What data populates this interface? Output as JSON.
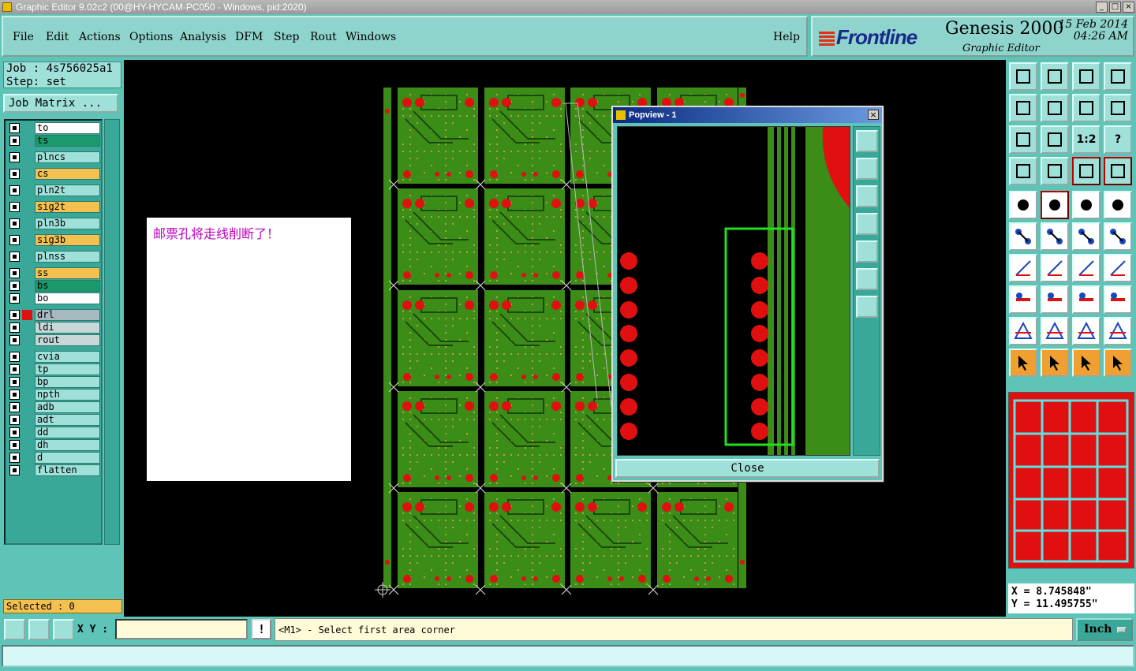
{
  "window": {
    "title": "Graphic Editor 9.02c2 (00@HY-HYCAM-PC050 - Windows, pid:2020)"
  },
  "menu": [
    "File",
    "Edit",
    "Actions",
    "Options",
    "Analysis",
    "DFM",
    "Step",
    "Rout",
    "Windows"
  ],
  "help": "Help",
  "brand": {
    "logo": "Frontline",
    "product": "Genesis 2000",
    "subtitle": "Graphic Editor",
    "date": "15 Feb 2014",
    "time": "04:26 AM"
  },
  "job": {
    "job_line": "Job : 4s756025a1",
    "step_line": "Step: set",
    "matrix_button": "Job Matrix ..."
  },
  "layers": [
    {
      "name": "to",
      "color": "#ffffff"
    },
    {
      "name": "ts",
      "color": "#1a9a6a"
    },
    {
      "name": "plncs",
      "color": "#9fe0d8"
    },
    {
      "name": "cs",
      "color": "#f4c050"
    },
    {
      "name": "pln2t",
      "color": "#9fe0d8"
    },
    {
      "name": "sig2t",
      "color": "#f4c050"
    },
    {
      "name": "pln3b",
      "color": "#9fe0d8"
    },
    {
      "name": "sig3b",
      "color": "#f4c050"
    },
    {
      "name": "plnss",
      "color": "#9fe0d8"
    },
    {
      "name": "ss",
      "color": "#f4c050"
    },
    {
      "name": "bs",
      "color": "#1a9a6a"
    },
    {
      "name": "bo",
      "color": "#ffffff"
    },
    {
      "name": "drl",
      "color": "#a8b8c0"
    },
    {
      "name": "ldi",
      "color": "#c8d8d8"
    },
    {
      "name": "rout",
      "color": "#c8d8d8"
    },
    {
      "name": "cvia",
      "color": "#9fe0d8"
    },
    {
      "name": "tp",
      "color": "#9fe0d8"
    },
    {
      "name": "bp",
      "color": "#9fe0d8"
    },
    {
      "name": "npth",
      "color": "#9fe0d8"
    },
    {
      "name": "adb",
      "color": "#9fe0d8"
    },
    {
      "name": "adt",
      "color": "#9fe0d8"
    },
    {
      "name": "dd",
      "color": "#9fe0d8"
    },
    {
      "name": "dh",
      "color": "#9fe0d8"
    },
    {
      "name": "d",
      "color": "#9fe0d8"
    },
    {
      "name": "flatten",
      "color": "#9fe0d8"
    }
  ],
  "selected": "Selected : 0",
  "note": "邮票孔将走线削断了！",
  "popview": {
    "title": "Popview - 1",
    "close": "Close"
  },
  "coords": {
    "x": "X = 8.745848\"",
    "y": "Y = 11.495755\""
  },
  "bottom": {
    "xy_label": "X Y :",
    "xy_value": "",
    "excl": "!",
    "prompt": "<M1> - Select first area corner",
    "unit": "Inch"
  },
  "tool_labels": {
    "ratio": "1:2",
    "help": "?"
  }
}
